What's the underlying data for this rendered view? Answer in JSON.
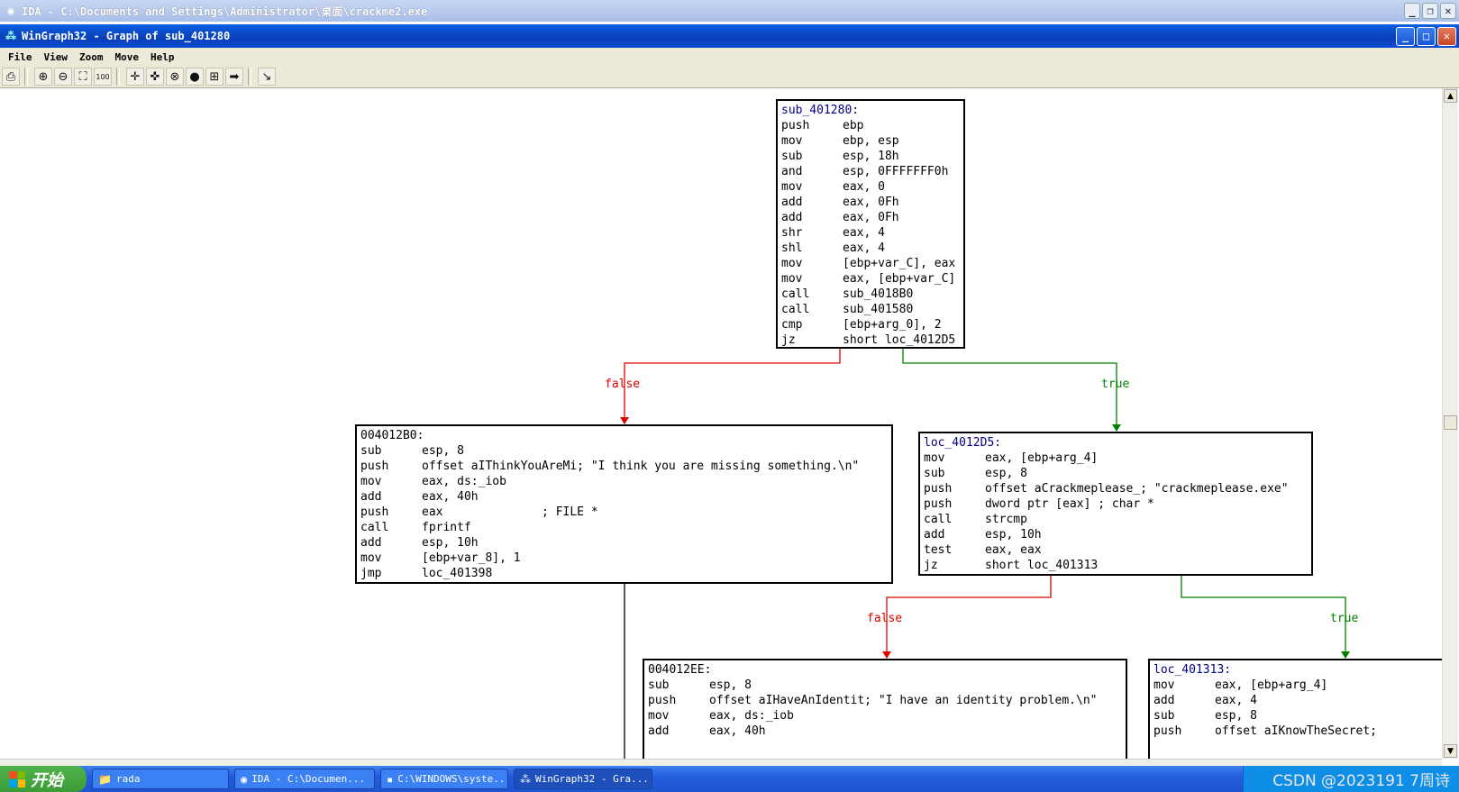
{
  "outer_window": {
    "title": "IDA - C:\\Documents and Settings\\Administrator\\桌面\\crackme2.exe"
  },
  "window": {
    "title": "WinGraph32 - Graph of sub_401280"
  },
  "menu": [
    "File",
    "View",
    "Zoom",
    "Move",
    "Help"
  ],
  "toolbar": {
    "icons": [
      "print-icon",
      "zoom-in-icon",
      "zoom-out-icon",
      "fit-icon",
      "zoom-100-icon",
      "center-icon",
      "move-icon",
      "arrows-icon",
      "green-circle-icon",
      "box-icon",
      "arrow-right-icon",
      "select-icon"
    ],
    "glyphs": [
      "⎙",
      "⊕",
      "⊖",
      "⛶",
      "100",
      "✛",
      "✜",
      "⊗",
      "●",
      "⊞",
      "➡",
      "↘"
    ]
  },
  "nodes": [
    {
      "id": "n1",
      "header": "sub_401280:",
      "header_color": "blue",
      "lines": [
        [
          "push",
          "ebp"
        ],
        [
          "mov",
          "ebp, esp"
        ],
        [
          "sub",
          "esp, 18h"
        ],
        [
          "and",
          "esp, 0FFFFFFF0h"
        ],
        [
          "mov",
          "eax, 0"
        ],
        [
          "add",
          "eax, 0Fh"
        ],
        [
          "add",
          "eax, 0Fh"
        ],
        [
          "shr",
          "eax, 4"
        ],
        [
          "shl",
          "eax, 4"
        ],
        [
          "mov",
          "[ebp+var_C], eax"
        ],
        [
          "mov",
          "eax, [ebp+var_C]"
        ],
        [
          "call",
          "sub_4018B0"
        ],
        [
          "call",
          "sub_401580"
        ],
        [
          "cmp",
          "[ebp+arg_0], 2"
        ],
        [
          "jz",
          "short loc_4012D5"
        ]
      ]
    },
    {
      "id": "n2",
      "header": "004012B0:",
      "header_color": "black",
      "lines": [
        [
          "sub",
          "esp, 8"
        ],
        [
          "push",
          "offset aIThinkYouAreMi; \"I think you are missing something.\\n\""
        ],
        [
          "mov",
          "eax, ds:_iob"
        ],
        [
          "add",
          "eax, 40h"
        ],
        [
          "push",
          "eax              ; FILE *"
        ],
        [
          "call",
          "fprintf"
        ],
        [
          "add",
          "esp, 10h"
        ],
        [
          "mov",
          "[ebp+var_8], 1"
        ],
        [
          "jmp",
          "loc_401398"
        ]
      ]
    },
    {
      "id": "n3",
      "header": "loc_4012D5:",
      "header_color": "blue",
      "lines": [
        [
          "mov",
          "eax, [ebp+arg_4]"
        ],
        [
          "sub",
          "esp, 8"
        ],
        [
          "push",
          "offset aCrackmeplease_; \"crackmeplease.exe\""
        ],
        [
          "push",
          "dword ptr [eax] ; char *"
        ],
        [
          "call",
          "strcmp"
        ],
        [
          "add",
          "esp, 10h"
        ],
        [
          "test",
          "eax, eax"
        ],
        [
          "jz",
          "short loc_401313"
        ]
      ]
    },
    {
      "id": "n4",
      "header": "004012EE:",
      "header_color": "black",
      "lines": [
        [
          "sub",
          "esp, 8"
        ],
        [
          "push",
          "offset aIHaveAnIdentit; \"I have an identity problem.\\n\""
        ],
        [
          "mov",
          "eax, ds:_iob"
        ],
        [
          "add",
          "eax, 40h"
        ]
      ]
    },
    {
      "id": "n5",
      "header": "loc_401313:",
      "header_color": "blue",
      "lines": [
        [
          "mov",
          "eax, [ebp+arg_4]"
        ],
        [
          "add",
          "eax, 4"
        ],
        [
          "sub",
          "esp, 8"
        ],
        [
          "push",
          "offset aIKnowTheSecret;"
        ]
      ]
    }
  ],
  "edge_labels": {
    "false": "false",
    "true": "true"
  },
  "colors": {
    "false_edge": "#e00000",
    "true_edge": "#008000",
    "plain_edge": "#000000",
    "label_blue": "#000080"
  },
  "taskbar": {
    "start_label": "开始",
    "tasks": [
      {
        "icon": "folder-icon",
        "glyph": "📁",
        "label": "rada"
      },
      {
        "icon": "ida-icon",
        "glyph": "◉",
        "label": "IDA - C:\\Documen..."
      },
      {
        "icon": "cmd-icon",
        "glyph": "▪",
        "label": "C:\\WINDOWS\\syste..."
      },
      {
        "icon": "wingraph-icon",
        "glyph": "⁂",
        "label": "WinGraph32 - Gra..."
      }
    ],
    "tray_text": "CSDN @2023191 7周诗"
  }
}
